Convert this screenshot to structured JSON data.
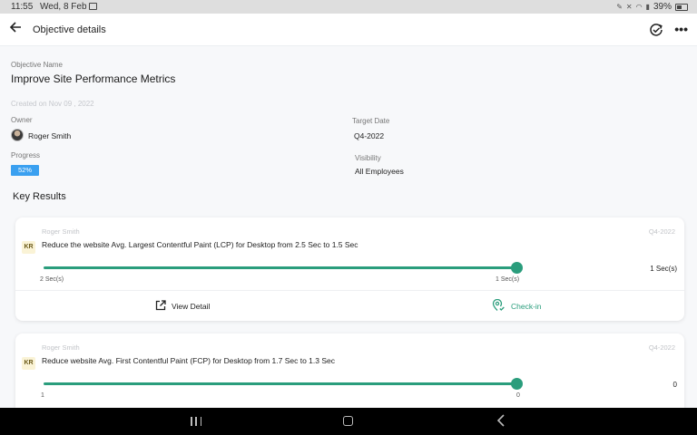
{
  "statusbar": {
    "time": "11:55",
    "date": "Wed, 8 Feb",
    "battery": "39%"
  },
  "appbar": {
    "title": "Objective details"
  },
  "objective": {
    "name_label": "Objective Name",
    "name": "Improve Site Performance Metrics",
    "created": "Created on Nov 09 , 2022",
    "owner_label": "Owner",
    "owner": "Roger Smith",
    "target_label": "Target Date",
    "target": "Q4-2022",
    "progress_label": "Progress",
    "progress": "52%",
    "visibility_label": "Visibility",
    "visibility": "All Employees"
  },
  "key_results": {
    "heading": "Key Results",
    "items": [
      {
        "owner": "Roger Smith",
        "date": "Q4-2022",
        "badge": "KR",
        "title": "Reduce the website Avg. Largest Contentful Paint (LCP) for Desktop from 2.5 Sec to 1.5 Sec",
        "start": "2 Sec(s)",
        "end": "1 Sec(s)",
        "current": "1 Sec(s)",
        "view_label": "View Detail",
        "checkin_label": "Check-in"
      },
      {
        "owner": "Roger Smith",
        "date": "Q4-2022",
        "badge": "KR",
        "title": "Reduce website Avg. First Contentful Paint (FCP) for Desktop from 1.7 Sec to 1.3 Sec",
        "start": "1",
        "end": "0",
        "current": "0"
      }
    ]
  },
  "colors": {
    "accent": "#2a9d7c",
    "progress_badge": "#3aa0f0"
  }
}
